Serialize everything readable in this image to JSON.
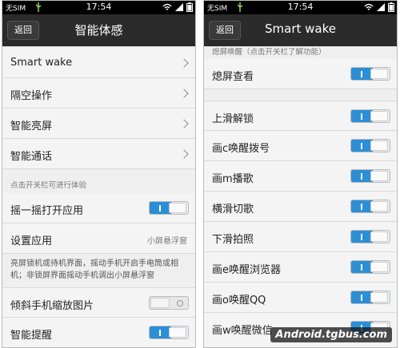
{
  "status": {
    "sim": "无SIM",
    "time": "17:54"
  },
  "left": {
    "back_label": "返回",
    "title": "智能体感",
    "menu": [
      {
        "label": "Smart wake"
      },
      {
        "label": "隔空操作"
      },
      {
        "label": "智能亮屏"
      },
      {
        "label": "智能通话"
      }
    ],
    "section_label": "点击开关栏可进行体验",
    "shake": {
      "label": "摇一摇打开应用",
      "on": true
    },
    "set_app": {
      "label": "设置应用",
      "value": "小屏悬浮窗"
    },
    "shake_desc": "亮屏锁机或待机界面，摇动手机开启手电筒或相机；非锁屏界面摇动手机调出小屏悬浮窗",
    "tilt": {
      "label": "倾斜手机缩放图片",
      "on": false
    },
    "smart_remind": {
      "label": "智能提醒",
      "on": true
    }
  },
  "right": {
    "back_label": "返回",
    "title": "Smart wake",
    "section_label": "熄屏唤醒（点击开关栏了解功能）",
    "items": [
      {
        "label": "熄屏查看",
        "on": true
      },
      {
        "label": "上滑解锁",
        "on": true
      },
      {
        "label": "画c唤醒拨号",
        "on": true
      },
      {
        "label": "画m播歌",
        "on": true
      },
      {
        "label": "横滑切歌",
        "on": true
      },
      {
        "label": "下滑拍照",
        "on": true
      },
      {
        "label": "画e唤醒浏览器",
        "on": true
      },
      {
        "label": "画o唤醒QQ",
        "on": true
      },
      {
        "label": "画w唤醒微信",
        "on": true
      }
    ]
  },
  "watermark": "Android.tgbus.com",
  "colors": {
    "toggle_on": "#2c8fd6",
    "titlebar": "#2b2b2b"
  }
}
